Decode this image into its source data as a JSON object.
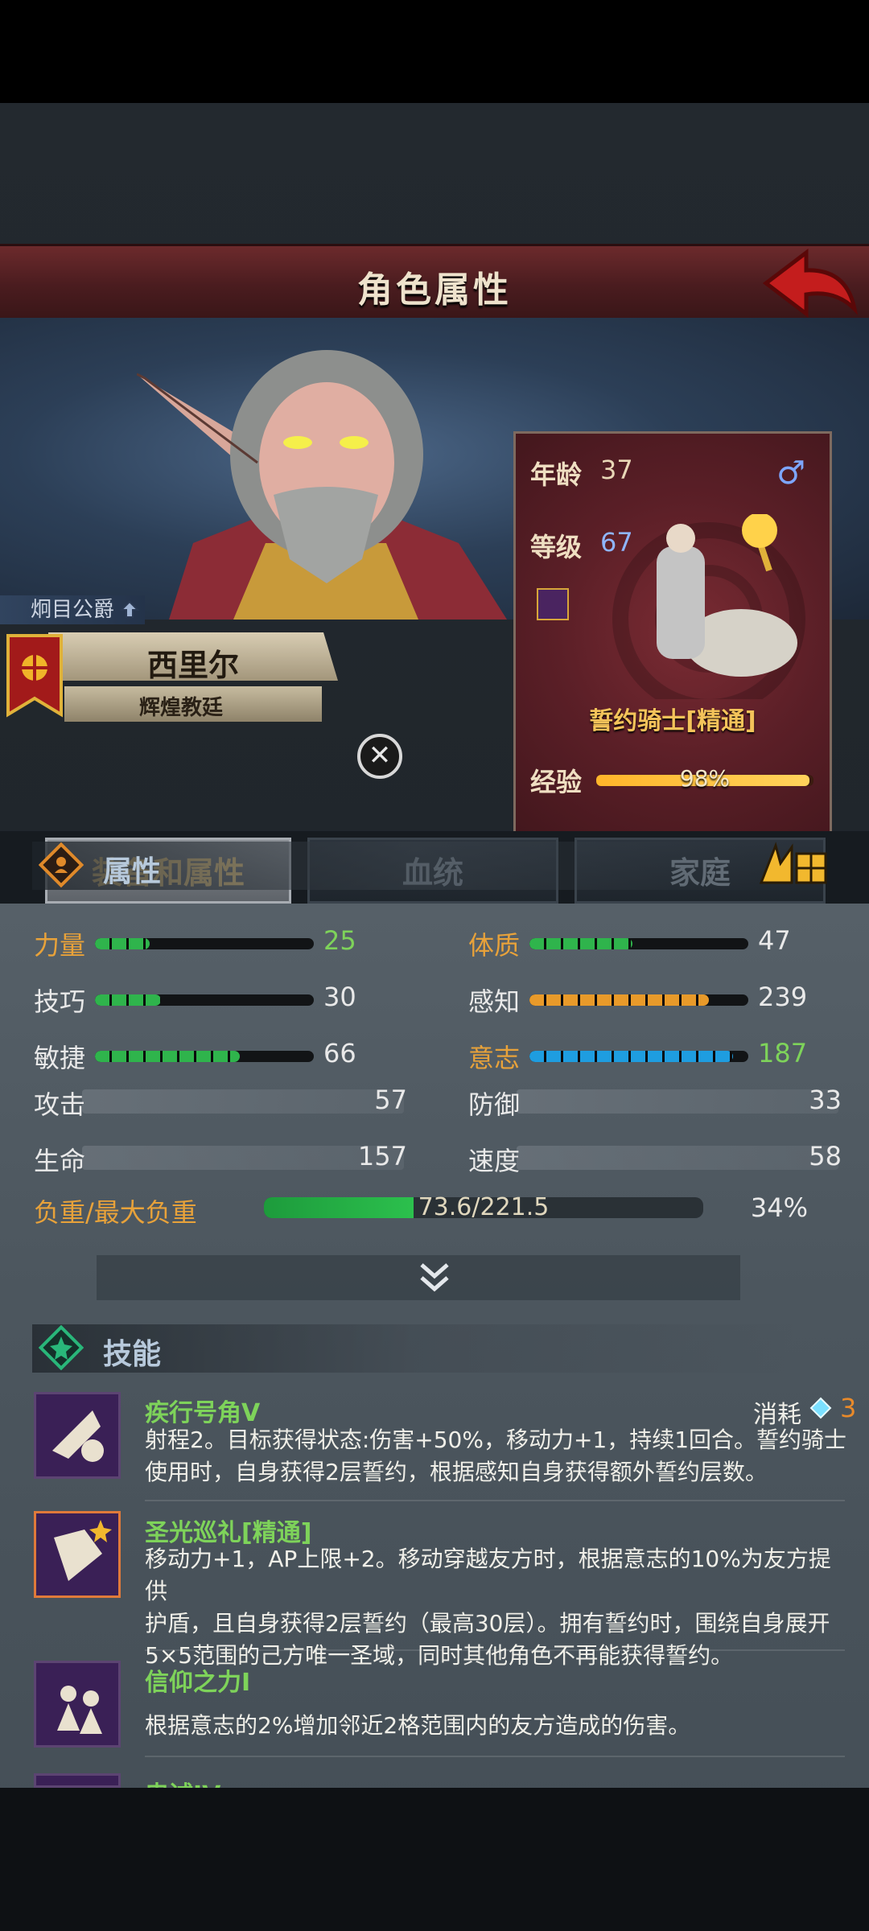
{
  "header": {
    "title": "角色属性"
  },
  "hero": {
    "rank": "炯目公爵",
    "name": "西里尔",
    "faction": "辉煌教廷"
  },
  "card": {
    "age_label": "年龄",
    "age": "37",
    "level_label": "等级",
    "level": "67",
    "gender_symbol": "♂",
    "class_name": "誓约骑士[精通]",
    "exp_label": "经验",
    "exp_text": "98%",
    "exp_fraction": 0.98
  },
  "tabs": [
    {
      "label": "装备和属性",
      "active": true
    },
    {
      "label": "血统",
      "active": false
    },
    {
      "label": "家庭",
      "active": false
    }
  ],
  "attributes": {
    "section_title": "属性",
    "left": [
      {
        "label": "力量",
        "value": "25",
        "label_color": "#e8a23a",
        "value_color": "#7ed35a",
        "bar_color": "#2fb44c",
        "fill": 0.25
      },
      {
        "label": "技巧",
        "value": "30",
        "label_color": "#e9e9e9",
        "value_color": "#e9e9e9",
        "bar_color": "#2fb44c",
        "fill": 0.3
      },
      {
        "label": "敏捷",
        "value": "66",
        "label_color": "#e9e9e9",
        "value_color": "#e9e9e9",
        "bar_color": "#2fb44c",
        "fill": 0.66
      }
    ],
    "right": [
      {
        "label": "体质",
        "value": "47",
        "label_color": "#e8a23a",
        "value_color": "#e9e9e9",
        "bar_color": "#2fb44c",
        "fill": 0.47
      },
      {
        "label": "感知",
        "value": "239",
        "label_color": "#e9e9e9",
        "value_color": "#e9e9e9",
        "bar_color": "#e89a2a",
        "fill": 0.82
      },
      {
        "label": "意志",
        "value": "187",
        "label_color": "#e8a23a",
        "value_color": "#7ed35a",
        "bar_color": "#1e9de0",
        "fill": 0.93
      }
    ],
    "derived_left": [
      {
        "label": "攻击",
        "value": "57"
      },
      {
        "label": "生命",
        "value": "157"
      }
    ],
    "derived_right": [
      {
        "label": "防御",
        "value": "33"
      },
      {
        "label": "速度",
        "value": "58"
      }
    ],
    "load_label": "负重/最大负重",
    "load_text": "73.6/221.5",
    "load_percent": "34%",
    "load_fraction": 0.34
  },
  "skills": {
    "section_title": "技能",
    "cost_label": "消耗",
    "cost_value": "3",
    "items": [
      {
        "name": "疾行号角V",
        "lines": [
          "射程2。目标获得状态:伤害+50%，移动力+1，持续1回合。誓约骑士",
          "使用时，自身获得2层誓约，根据感知自身获得额外誓约层数。"
        ]
      },
      {
        "name": "圣光巡礼[精通]",
        "lines": [
          "移动力+1，AP上限+2。移动穿越友方时，根据意志的10%为友方提供",
          "护盾，且自身获得2层誓约（最高30层）。拥有誓约时，围绕自身展开",
          "5×5范围的己方唯一圣域，同时其他角色不再能获得誓约。"
        ]
      },
      {
        "name": "信仰之力I",
        "lines": [
          "根据意志的2%增加邻近2格范围内的友方造成的伤害。"
        ]
      },
      {
        "name": "忠诚IV",
        "lines": []
      }
    ]
  }
}
